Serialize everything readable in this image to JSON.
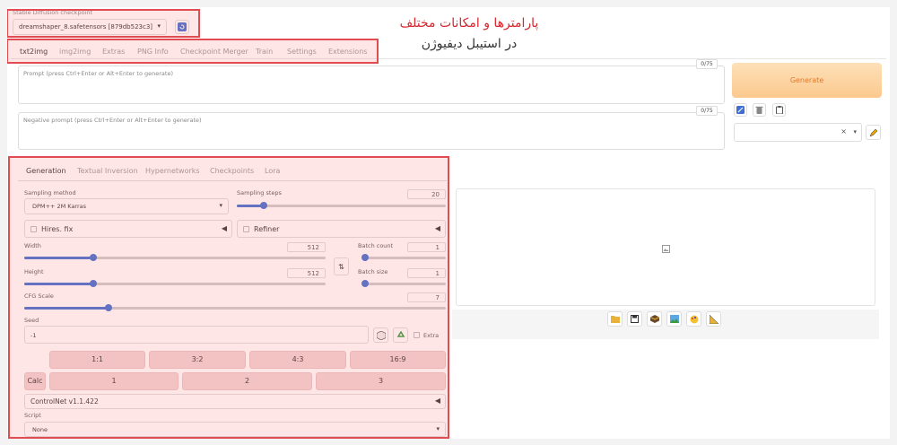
{
  "checkpoint": {
    "label": "Stable Diffusion checkpoint",
    "value": "dreamshaper_8.safetensors [879db523c3]"
  },
  "annotation": {
    "line1": "پارامترها و امکانات مختلف",
    "line2": "در استیبل دیفیوژن"
  },
  "top_tabs": [
    "txt2img",
    "img2img",
    "Extras",
    "PNG Info",
    "Checkpoint Merger",
    "Train",
    "Settings",
    "Extensions"
  ],
  "prompt": {
    "placeholder": "Prompt (press Ctrl+Enter or Alt+Enter to generate)",
    "counter": "0/75"
  },
  "negative_prompt": {
    "placeholder": "Negative prompt (press Ctrl+Enter or Alt+Enter to generate)",
    "counter": "0/75"
  },
  "generate_label": "Generate",
  "style_select_clear": "×",
  "sub_tabs": [
    "Generation",
    "Textual Inversion",
    "Hypernetworks",
    "Checkpoints",
    "Lora"
  ],
  "sampling_method": {
    "label": "Sampling method",
    "value": "DPM++ 2M Karras"
  },
  "sampling_steps": {
    "label": "Sampling steps",
    "value": "20",
    "fraction": 0.13
  },
  "hires_fix": {
    "label": "Hires. fix"
  },
  "refiner": {
    "label": "Refiner"
  },
  "width": {
    "label": "Width",
    "value": "512",
    "fraction": 0.23
  },
  "height": {
    "label": "Height",
    "value": "512",
    "fraction": 0.23
  },
  "batch_count": {
    "label": "Batch count",
    "value": "1",
    "fraction": 0.0
  },
  "batch_size": {
    "label": "Batch size",
    "value": "1",
    "fraction": 0.0
  },
  "cfg_scale": {
    "label": "CFG Scale",
    "value": "7",
    "fraction": 0.2
  },
  "seed": {
    "label": "Seed",
    "value": "-1",
    "extra_label": "Extra"
  },
  "ratio_buttons": [
    "1:1",
    "3:2",
    "4:3",
    "16:9"
  ],
  "calc_label": "Calc",
  "calc_buttons": [
    "1",
    "2",
    "3"
  ],
  "controlnet_label": "ControlNet v1.1.422",
  "script": {
    "label": "Script",
    "value": "None"
  },
  "colors": {
    "accent": "#3f6fd3",
    "generate_bg": "#fcd6a7",
    "annotation_red": "#d6262d"
  }
}
